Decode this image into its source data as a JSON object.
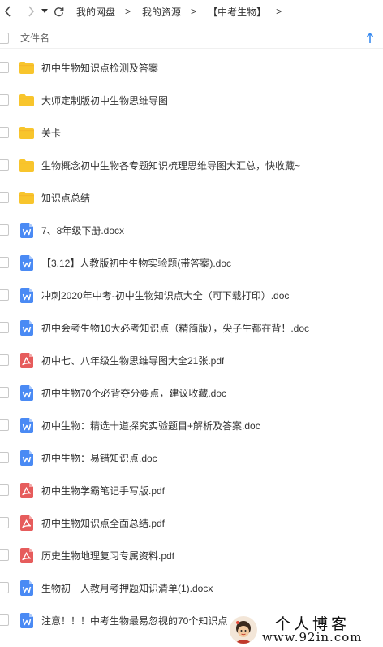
{
  "toolbar": {
    "breadcrumbs": [
      "我的网盘",
      "我的资源",
      "【中考生物】"
    ],
    "separator": ">"
  },
  "header": {
    "column_label": "文件名"
  },
  "files": [
    {
      "name": "初中生物知识点检测及答案",
      "type": "folder"
    },
    {
      "name": "大师定制版初中生物思维导图",
      "type": "folder"
    },
    {
      "name": "关卡",
      "type": "folder"
    },
    {
      "name": "生物概念初中生物各专题知识梳理思维导图大汇总，快收藏~",
      "type": "folder"
    },
    {
      "name": "知识点总结",
      "type": "folder"
    },
    {
      "name": "7、8年级下册.docx",
      "type": "word"
    },
    {
      "name": "【3.12】人教版初中生物实验题(带答案).doc",
      "type": "word"
    },
    {
      "name": "冲刺2020年中考-初中生物知识点大全（可下载打印）.doc",
      "type": "word"
    },
    {
      "name": "初中会考生物10大必考知识点（精简版），尖子生都在背！.doc",
      "type": "word"
    },
    {
      "name": "初中七、八年级生物思维导图大全21张.pdf",
      "type": "pdf"
    },
    {
      "name": "初中生物70个必背夺分要点，建议收藏.doc",
      "type": "word"
    },
    {
      "name": "初中生物：精选十道探究实验题目+解析及答案.doc",
      "type": "word"
    },
    {
      "name": "初中生物：易错知识点.doc",
      "type": "word"
    },
    {
      "name": "初中生物学霸笔记手写版.pdf",
      "type": "pdf"
    },
    {
      "name": "初中生物知识点全面总结.pdf",
      "type": "pdf"
    },
    {
      "name": "历史生物地理复习专属资料.pdf",
      "type": "pdf"
    },
    {
      "name": "生物初一人教月考押题知识清单(1).docx",
      "type": "word"
    },
    {
      "name": "注意！！！中考生物最易忽视的70个知识点",
      "type": "word"
    }
  ],
  "watermark": {
    "title": "个人博客",
    "url": "www.92in.com"
  },
  "colors": {
    "folder": "#f8c52c",
    "word": "#4a8af4",
    "pdf": "#e65c5c",
    "accent": "#3b8cf0"
  }
}
